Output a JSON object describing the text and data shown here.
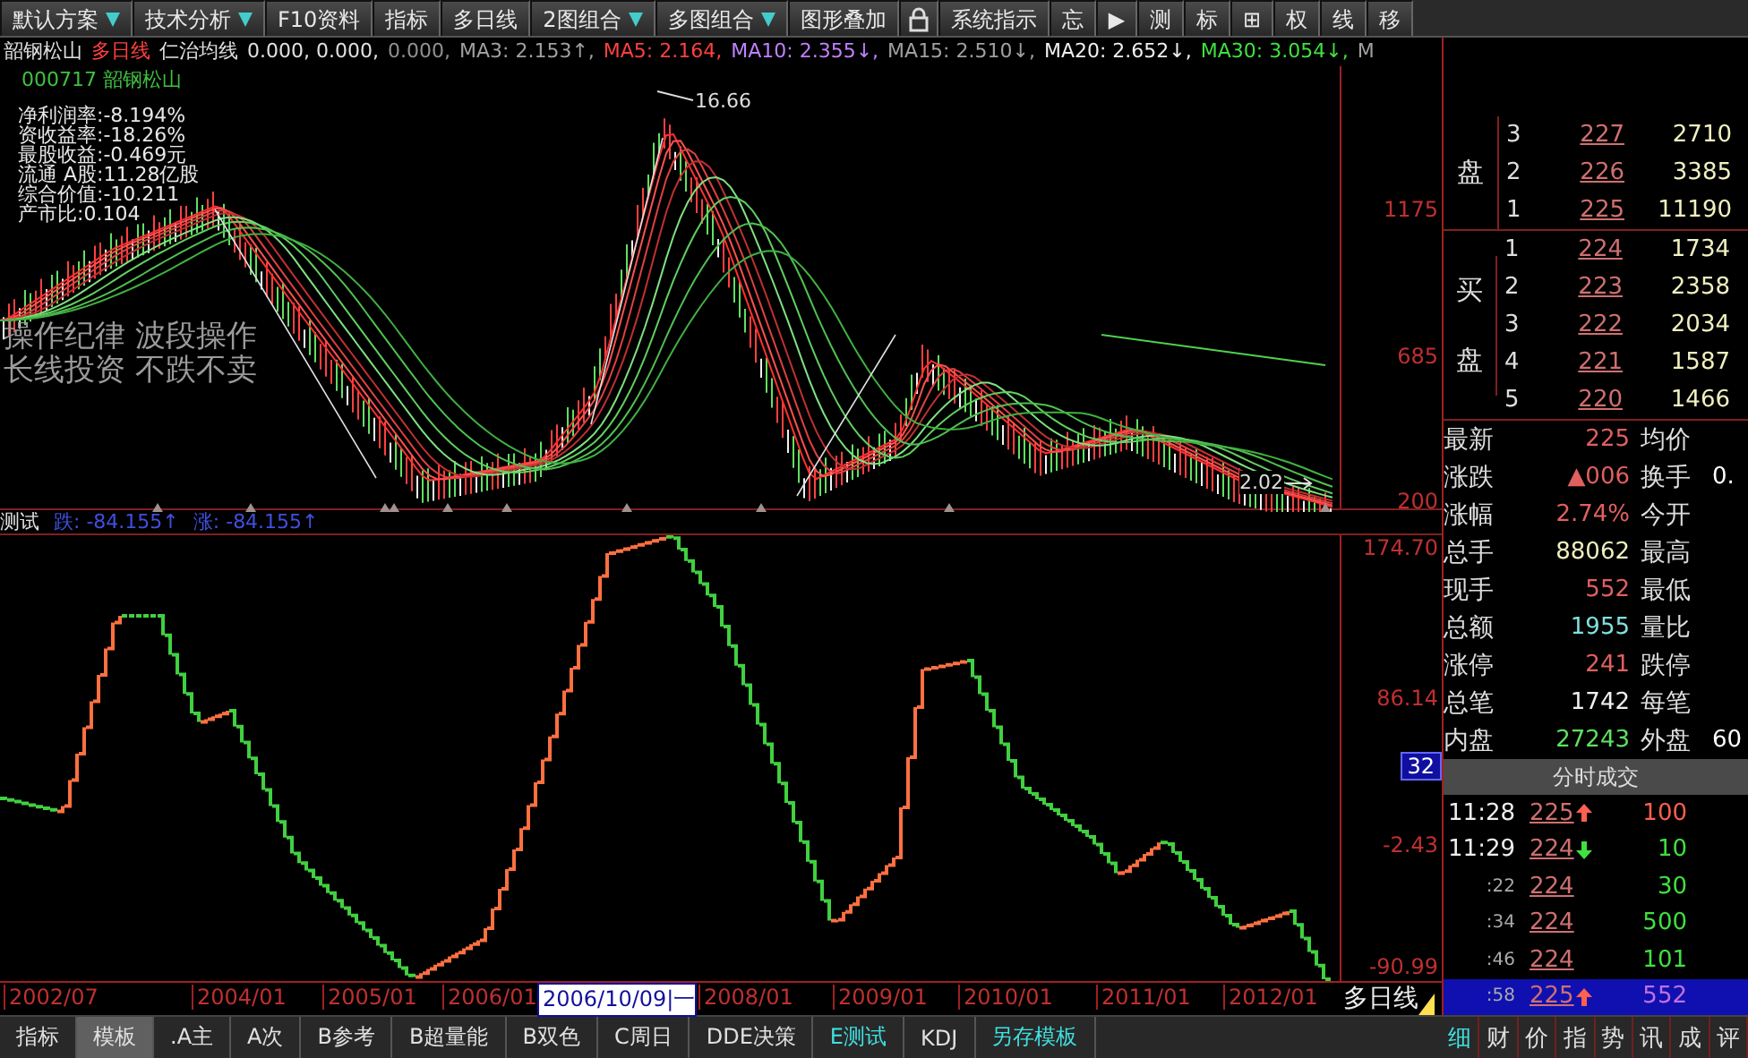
{
  "toolbar": [
    {
      "kind": "button",
      "label": "默认方案",
      "dropdown": true
    },
    {
      "kind": "button",
      "label": "技术分析",
      "dropdown": true
    },
    {
      "kind": "button",
      "label": "F10资料",
      "dropdown": false
    },
    {
      "kind": "button",
      "label": "指标",
      "dropdown": false
    },
    {
      "kind": "button",
      "label": "多日线",
      "dropdown": false
    },
    {
      "kind": "button",
      "label": "2图组合",
      "dropdown": true
    },
    {
      "kind": "button",
      "label": "多图组合",
      "dropdown": true
    },
    {
      "kind": "button",
      "label": "图形叠加",
      "dropdown": false
    },
    {
      "kind": "lock"
    },
    {
      "kind": "button",
      "label": "系统指示",
      "dropdown": false
    },
    {
      "kind": "button",
      "label": "忘",
      "dropdown": false
    },
    {
      "kind": "button",
      "label": "▶",
      "dropdown": false
    },
    {
      "kind": "button",
      "label": "测",
      "dropdown": false
    },
    {
      "kind": "button",
      "label": "标",
      "dropdown": false
    },
    {
      "kind": "button",
      "label": "⊞",
      "dropdown": false
    },
    {
      "kind": "button",
      "label": "权",
      "dropdown": false
    },
    {
      "kind": "button",
      "label": "线",
      "dropdown": false
    },
    {
      "kind": "button",
      "label": "移",
      "dropdown": false
    }
  ],
  "info_line": [
    {
      "text": "韶钢松山",
      "color": "#e0e0e0"
    },
    {
      "text": "多日线",
      "color": "#ff4040"
    },
    {
      "text": "仁治均线",
      "color": "#e0e0e0"
    },
    {
      "text": "0.000, 0.000,",
      "color": "#e0e0e0"
    },
    {
      "text": "0.000,",
      "color": "#909090"
    },
    {
      "text": "MA3: 2.153↑,",
      "color": "#a0a0a0"
    },
    {
      "text": "MA5: 2.164,",
      "color": "#ff4040"
    },
    {
      "text": "MA10: 2.355↓,",
      "color": "#c080ff"
    },
    {
      "text": "MA15: 2.510↓,",
      "color": "#a0a0a0"
    },
    {
      "text": "MA20: 2.652↓,",
      "color": "#f0f0f0"
    },
    {
      "text": "MA30: 3.054↓,",
      "color": "#40e040"
    },
    {
      "text": "M",
      "color": "#a0a0a0"
    }
  ],
  "price_chart": {
    "code": "000717 韶钢松山",
    "fundamentals": [
      "净利润率:-8.194%",
      "资收益率:-18.26%",
      "最股收益:-0.469元",
      "流通 A股:11.28亿股",
      "综合价值:-10.211",
      "产市比:0.104"
    ],
    "peak_label": "16.66",
    "last_label": "2.02",
    "caption": [
      "操作纪律 波段操作",
      "长线投资 不跌不卖"
    ],
    "axis_labels": [
      "1175",
      "685",
      "200"
    ]
  },
  "indicator": {
    "name": "测试",
    "readings": [
      "跌: -84.155↑",
      "涨: -84.155↑"
    ],
    "axis_labels": [
      "174.70",
      "86.14",
      "-2.43",
      "-90.99"
    ],
    "cursor_value": "32"
  },
  "date_axis": [
    {
      "label": "2002/07",
      "cursor": false
    },
    {
      "label": "2004/01",
      "cursor": false
    },
    {
      "label": "2005/01",
      "cursor": false
    },
    {
      "label": "2006/01",
      "cursor": false
    },
    {
      "label": "2006/10/09|一",
      "cursor": true
    },
    {
      "label": "2008/01",
      "cursor": false
    },
    {
      "label": "2009/01",
      "cursor": false
    },
    {
      "label": "2010/01",
      "cursor": false
    },
    {
      "label": "2011/01",
      "cursor": false
    },
    {
      "label": "2012/01",
      "cursor": false
    }
  ],
  "period_label": "多日线",
  "bottom_tabs": [
    {
      "label": "指标",
      "selected": false,
      "color": "#e0e0e0"
    },
    {
      "label": "模板",
      "selected": true,
      "color": "#e0e0e0"
    },
    {
      "label": ".A主",
      "selected": false,
      "color": "#e0e0e0"
    },
    {
      "label": "A次",
      "selected": false,
      "color": "#e0e0e0"
    },
    {
      "label": "B参考",
      "selected": false,
      "color": "#e0e0e0"
    },
    {
      "label": "B超量能",
      "selected": false,
      "color": "#e0e0e0"
    },
    {
      "label": "B双色",
      "selected": false,
      "color": "#e0e0e0"
    },
    {
      "label": "C周日",
      "selected": false,
      "color": "#e0e0e0"
    },
    {
      "label": "DDE决策",
      "selected": false,
      "color": "#e0e0e0"
    },
    {
      "label": "E测试",
      "selected": false,
      "color": "#40e0e0"
    },
    {
      "label": "KDJ",
      "selected": false,
      "color": "#e0e0e0"
    },
    {
      "label": "另存模板",
      "selected": false,
      "color": "#40e0e0"
    }
  ],
  "order_book": {
    "sell_label": "盘",
    "sell": [
      {
        "level": "3",
        "price": "227",
        "volume": "2710"
      },
      {
        "level": "2",
        "price": "226",
        "volume": "3385"
      },
      {
        "level": "1",
        "price": "225",
        "volume": "11190"
      }
    ],
    "buy_label": "买盘",
    "buy": [
      {
        "level": "1",
        "price": "224",
        "volume": "1734"
      },
      {
        "level": "2",
        "price": "223",
        "volume": "2358"
      },
      {
        "level": "3",
        "price": "222",
        "volume": "2034"
      },
      {
        "level": "4",
        "price": "221",
        "volume": "1587"
      },
      {
        "level": "5",
        "price": "220",
        "volume": "1466"
      }
    ]
  },
  "stats": [
    {
      "label": "最新",
      "value": "225",
      "color": "#e06060",
      "label2": "均价"
    },
    {
      "label": "涨跌",
      "value": "▲006",
      "color": "#e06060",
      "label2": "换手",
      "value2": "0."
    },
    {
      "label": "涨幅",
      "value": "2.74%",
      "color": "#e06060",
      "label2": "今开"
    },
    {
      "label": "总手",
      "value": "88062",
      "color": "#f0f0c0",
      "label2": "最高"
    },
    {
      "label": "现手",
      "value": "552",
      "color": "#e06060",
      "label2": "最低"
    },
    {
      "label": "总额",
      "value": "1955",
      "color": "#80e0e0",
      "label2": "量比"
    },
    {
      "label": "涨停",
      "value": "241",
      "color": "#e06060",
      "label2": "跌停"
    },
    {
      "label": "总笔",
      "value": "1742",
      "color": "#f0f0f0",
      "label2": "每笔"
    },
    {
      "label": "内盘",
      "value": "27243",
      "color": "#60e060",
      "label2": "外盘",
      "value2": "60"
    }
  ],
  "trades_title": "分时成交",
  "trades": [
    {
      "time": "11:28",
      "price": "225",
      "up_arrow": true,
      "down_arrow": false,
      "volume": "100",
      "selected": false
    },
    {
      "time": "11:29",
      "price": "224",
      "up_arrow": false,
      "down_arrow": true,
      "volume": "10",
      "selected": false
    },
    {
      "time": ":22",
      "price": "224",
      "up_arrow": false,
      "down_arrow": false,
      "volume": "30",
      "selected": false
    },
    {
      "time": ":34",
      "price": "224",
      "up_arrow": false,
      "down_arrow": false,
      "volume": "500",
      "selected": false
    },
    {
      "time": ":46",
      "price": "224",
      "up_arrow": false,
      "down_arrow": false,
      "volume": "101",
      "selected": false
    },
    {
      "time": ":58",
      "price": "225",
      "up_arrow": true,
      "down_arrow": false,
      "volume": "552",
      "selected": true
    }
  ],
  "side_tabs": [
    {
      "label": "细",
      "selected": true
    },
    {
      "label": "财",
      "selected": false
    },
    {
      "label": "价",
      "selected": false
    },
    {
      "label": "指",
      "selected": false
    },
    {
      "label": "势",
      "selected": false
    },
    {
      "label": "讯",
      "selected": false
    },
    {
      "label": "成",
      "selected": false
    },
    {
      "label": "评",
      "selected": false
    }
  ]
}
